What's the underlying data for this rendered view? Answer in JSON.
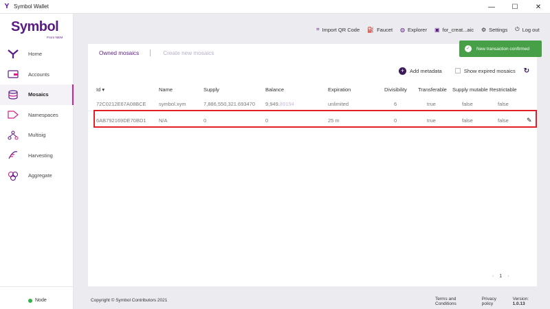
{
  "window": {
    "title": "Symbol Wallet",
    "logo": "Y"
  },
  "brand": {
    "name": "Symbol",
    "tagline": "From NEM"
  },
  "sidebar": {
    "items": [
      {
        "label": "Home",
        "icon": "Y"
      },
      {
        "label": "Accounts",
        "icon": "▭"
      },
      {
        "label": "Mosaics",
        "icon": "≋"
      },
      {
        "label": "Namespaces",
        "icon": "⌂"
      },
      {
        "label": "Multisig",
        "icon": "⚇"
      },
      {
        "label": "Harvesting",
        "icon": "⟟"
      },
      {
        "label": "Aggregate",
        "icon": "⚭"
      }
    ],
    "node_label": "Node"
  },
  "topbar": {
    "import_qr": "Import QR Code",
    "faucet": "Faucet",
    "explorer": "Explorer",
    "account": "for_creat...aic",
    "settings": "Settings",
    "logout": "Log out"
  },
  "tabs": {
    "owned": "Owned mosaics",
    "create": "Create new mosaics"
  },
  "actions": {
    "add_metadata": "Add metadata",
    "show_expired": "Show expired mosaics"
  },
  "table": {
    "headers": {
      "id": "Id ▾",
      "name": "Name",
      "supply": "Supply",
      "balance": "Balance",
      "expiration": "Expiration",
      "divisibility": "Divisibility",
      "transferable": "Transferable",
      "supply_mutable": "Supply mutable",
      "restrictable": "Restrictable"
    },
    "rows": [
      {
        "id": "72C0212E67A08BCE",
        "name": "symbol.xym",
        "supply": "7,886,550,321.693470",
        "balance_int": "9,949.",
        "balance_dec": "89194",
        "expiration": "unlimited",
        "divisibility": "6",
        "transferable": "true",
        "supply_mutable": "false",
        "restrictable": "false"
      },
      {
        "id": "6AB792169DE70BD1",
        "name": "N/A",
        "supply": "0",
        "balance_int": "0",
        "balance_dec": "",
        "expiration": "25 m",
        "divisibility": "0",
        "transferable": "true",
        "supply_mutable": "false",
        "restrictable": "false"
      }
    ]
  },
  "pagination": {
    "current": "1"
  },
  "footer": {
    "copyright": "Copyright © Symbol Contributors 2021",
    "terms": "Terms and Conditions",
    "privacy": "Privacy policy",
    "version_label": "Version:",
    "version": "1.0.13"
  },
  "toast": {
    "message": "New transaction confirmed"
  },
  "colors": {
    "brand": "#5a1c83",
    "accent": "#d81b8a",
    "success": "#47a048",
    "highlight": "#e21d24"
  }
}
